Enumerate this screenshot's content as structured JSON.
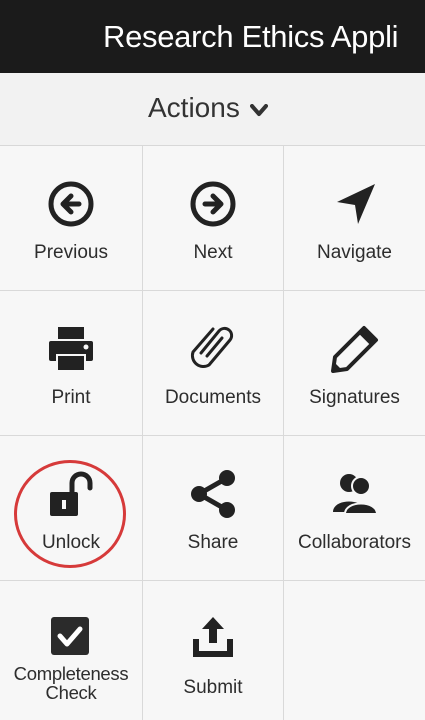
{
  "title_bar": {
    "title": "Research Ethics Appli"
  },
  "actions": {
    "label": "Actions",
    "icon": "chevron-down-icon"
  },
  "tiles": {
    "previous": {
      "label": "Previous",
      "icon": "arrow-circle-left-icon"
    },
    "next": {
      "label": "Next",
      "icon": "arrow-circle-right-icon"
    },
    "navigate": {
      "label": "Navigate",
      "icon": "location-arrow-icon"
    },
    "print": {
      "label": "Print",
      "icon": "printer-icon"
    },
    "documents": {
      "label": "Documents",
      "icon": "paperclip-icon"
    },
    "signatures": {
      "label": "Signatures",
      "icon": "pencil-icon"
    },
    "unlock": {
      "label": "Unlock",
      "icon": "unlock-icon"
    },
    "share": {
      "label": "Share",
      "icon": "share-icon"
    },
    "collaborators": {
      "label": "Collaborators",
      "icon": "users-icon"
    },
    "completeness_check": {
      "label": "Completeness Check",
      "icon": "check-square-icon"
    },
    "submit": {
      "label": "Submit",
      "icon": "upload-icon"
    }
  },
  "colors": {
    "title_bar_bg": "#1b1b1b",
    "tile_bg": "#f7f7f7",
    "icon_color": "#222222",
    "highlight_ring": "#d63a3a"
  }
}
